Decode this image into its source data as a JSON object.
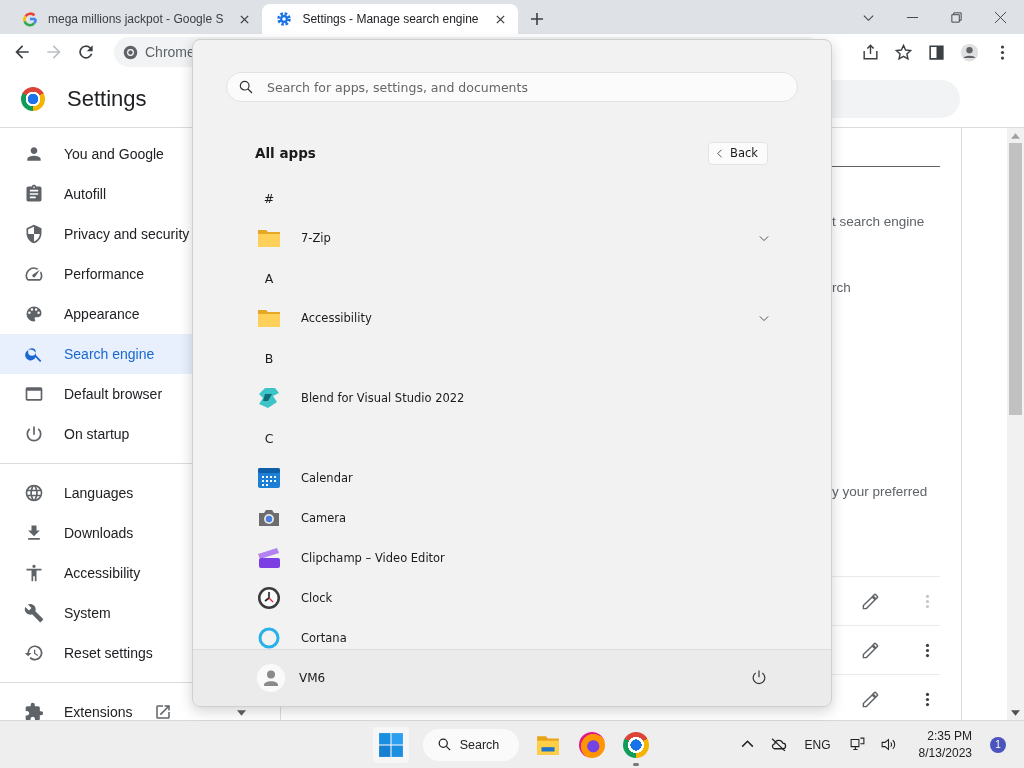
{
  "browser": {
    "tabs": [
      {
        "title": "mega millions jackpot - Google S",
        "kind": "google",
        "selected": false
      },
      {
        "title": "Settings - Manage search engine",
        "kind": "gear",
        "selected": true
      }
    ],
    "nav": [
      {
        "kind": "back",
        "disabled": false
      },
      {
        "kind": "forward",
        "disabled": true
      },
      {
        "kind": "reload",
        "disabled": false
      }
    ],
    "address": "Chrome"
  },
  "settings": {
    "title": "Settings",
    "sidebar": {
      "sections": [
        {
          "items": [
            {
              "label": "You and Google",
              "kind": "person",
              "selected": false
            },
            {
              "label": "Autofill",
              "kind": "autofill",
              "selected": false
            },
            {
              "label": "Privacy and security",
              "kind": "shield",
              "selected": false
            },
            {
              "label": "Performance",
              "kind": "gauge",
              "selected": false
            },
            {
              "label": "Appearance",
              "kind": "palette",
              "selected": false
            },
            {
              "label": "Search engine",
              "kind": "search",
              "selected": true
            },
            {
              "label": "Default browser",
              "kind": "browser",
              "selected": false
            },
            {
              "label": "On startup",
              "kind": "power",
              "selected": false
            }
          ]
        },
        {
          "items": [
            {
              "label": "Languages",
              "kind": "globe",
              "selected": false
            },
            {
              "label": "Downloads",
              "kind": "download",
              "selected": false
            },
            {
              "label": "Accessibility",
              "kind": "accessibility",
              "selected": false
            },
            {
              "label": "System",
              "kind": "wrench",
              "selected": false
            },
            {
              "label": "Reset settings",
              "kind": "history",
              "selected": false
            }
          ]
        },
        {
          "items": [
            {
              "label": "Extensions",
              "kind": "puzzle",
              "selected": false,
              "external": true
            }
          ]
        }
      ]
    },
    "content": {
      "texts": [
        "t search engine",
        "rch",
        "y your preferred"
      ],
      "rows": [
        {
          "more_disabled": true
        },
        {
          "more_disabled": false
        },
        {
          "more_disabled": false
        }
      ]
    }
  },
  "start_menu": {
    "search": {
      "placeholder": "Search for apps, settings, and documents"
    },
    "heading": "All apps",
    "back_button": "Back",
    "apps": [
      {
        "kind": "letter",
        "label": "#"
      },
      {
        "kind": "folder",
        "label": "7-Zip",
        "expandable": true
      },
      {
        "kind": "letter",
        "label": "A"
      },
      {
        "kind": "folder",
        "label": "Accessibility",
        "expandable": true
      },
      {
        "kind": "letter",
        "label": "B"
      },
      {
        "kind": "blend",
        "label": "Blend for Visual Studio 2022",
        "expandable": false
      },
      {
        "kind": "letter",
        "label": "C"
      },
      {
        "kind": "calendar",
        "label": "Calendar",
        "expandable": false
      },
      {
        "kind": "camera",
        "label": "Camera",
        "expandable": false
      },
      {
        "kind": "clipchamp",
        "label": "Clipchamp – Video Editor",
        "expandable": false
      },
      {
        "kind": "clock",
        "label": "Clock",
        "expandable": false
      },
      {
        "kind": "cortana",
        "label": "Cortana",
        "expandable": false
      }
    ],
    "user": {
      "name": "VM6"
    }
  },
  "taskbar": {
    "search": "Search",
    "apps": [
      {
        "kind": "explorer",
        "running": false
      },
      {
        "kind": "firefox",
        "running": false
      },
      {
        "kind": "chrome",
        "running": true
      }
    ],
    "tray": {
      "language": "ENG",
      "time": "2:35 PM",
      "date": "8/13/2023",
      "notifications": "1"
    }
  }
}
